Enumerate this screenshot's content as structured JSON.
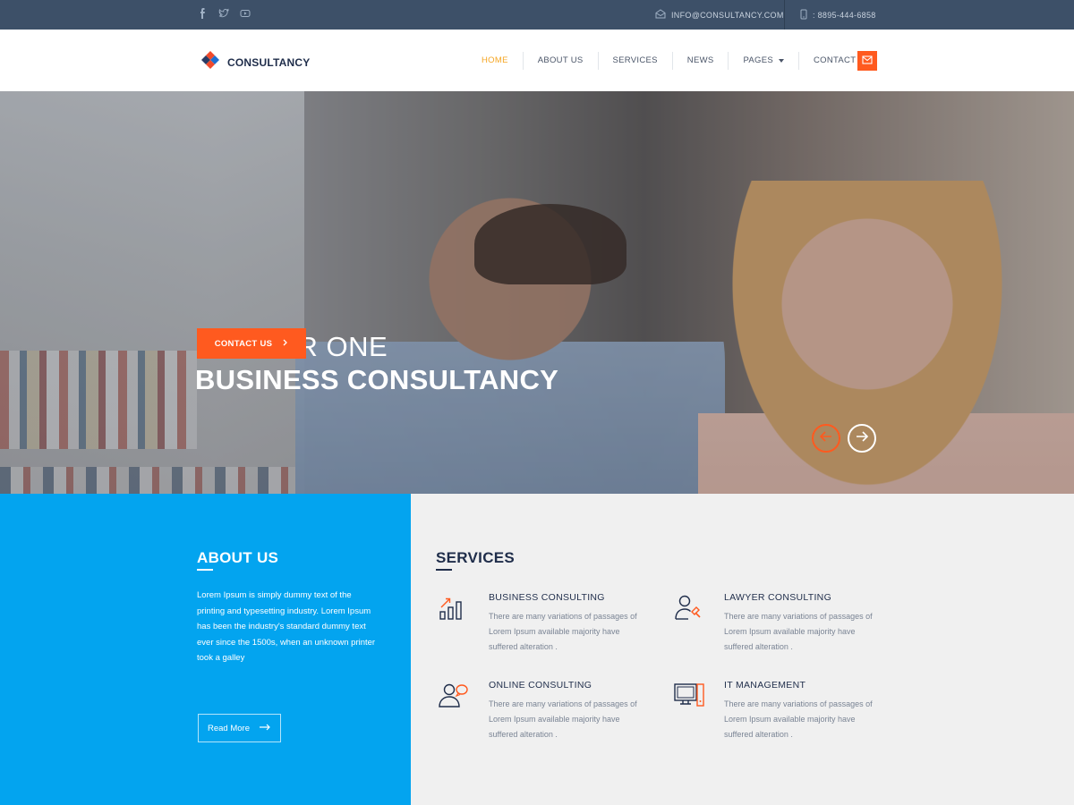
{
  "topbar": {
    "social_icons": [
      "facebook-icon",
      "twitter-icon",
      "youtube-icon"
    ],
    "email": "INFO@CONSULTANCY.COM",
    "phone": ": 8895-444-6858"
  },
  "header": {
    "brand": "CONSULTANCY",
    "nav": [
      {
        "label": "HOME",
        "active": true
      },
      {
        "label": "ABOUT US"
      },
      {
        "label": "SERVICES"
      },
      {
        "label": "NEWS"
      },
      {
        "label": "PAGES"
      },
      {
        "label": "CONTACT US"
      }
    ]
  },
  "hero": {
    "title_line1": "NUMBER ONE",
    "title_line2": "BUSINESS CONSULTANCY",
    "cta_label": "CONTACT US"
  },
  "about": {
    "heading": "ABOUT US",
    "text": "Lorem Ipsum is simply dummy text of the printing and typesetting industry. Lorem Ipsum has been the industry's standard dummy text ever since the 1500s, when an unknown printer took a galley",
    "button_label": "Read More"
  },
  "services": {
    "heading": "SERVICES",
    "items": [
      {
        "title": "BUSINESS CONSULTING",
        "desc": "There are many variations of passages of Lorem Ipsum available majority have suffered alteration .",
        "icon": "bar-chart-icon"
      },
      {
        "title": "LAWYER CONSULTING",
        "desc": "There are many variations of passages of Lorem Ipsum available majority have suffered alteration .",
        "icon": "lawyer-gavel-icon"
      },
      {
        "title": "ONLINE CONSULTING",
        "desc": "There are many variations of passages of Lorem Ipsum available majority have suffered alteration .",
        "icon": "user-chat-icon"
      },
      {
        "title": "IT MANAGEMENT",
        "desc": "There are many variations of passages of Lorem Ipsum available majority have suffered alteration .",
        "icon": "computer-icon"
      }
    ]
  },
  "colors": {
    "accent": "#ff5a1f",
    "nav_active": "#f5a623",
    "navy": "#1f2d4a",
    "topbar": "#3d5068",
    "about_blue": "#03a4ef"
  }
}
